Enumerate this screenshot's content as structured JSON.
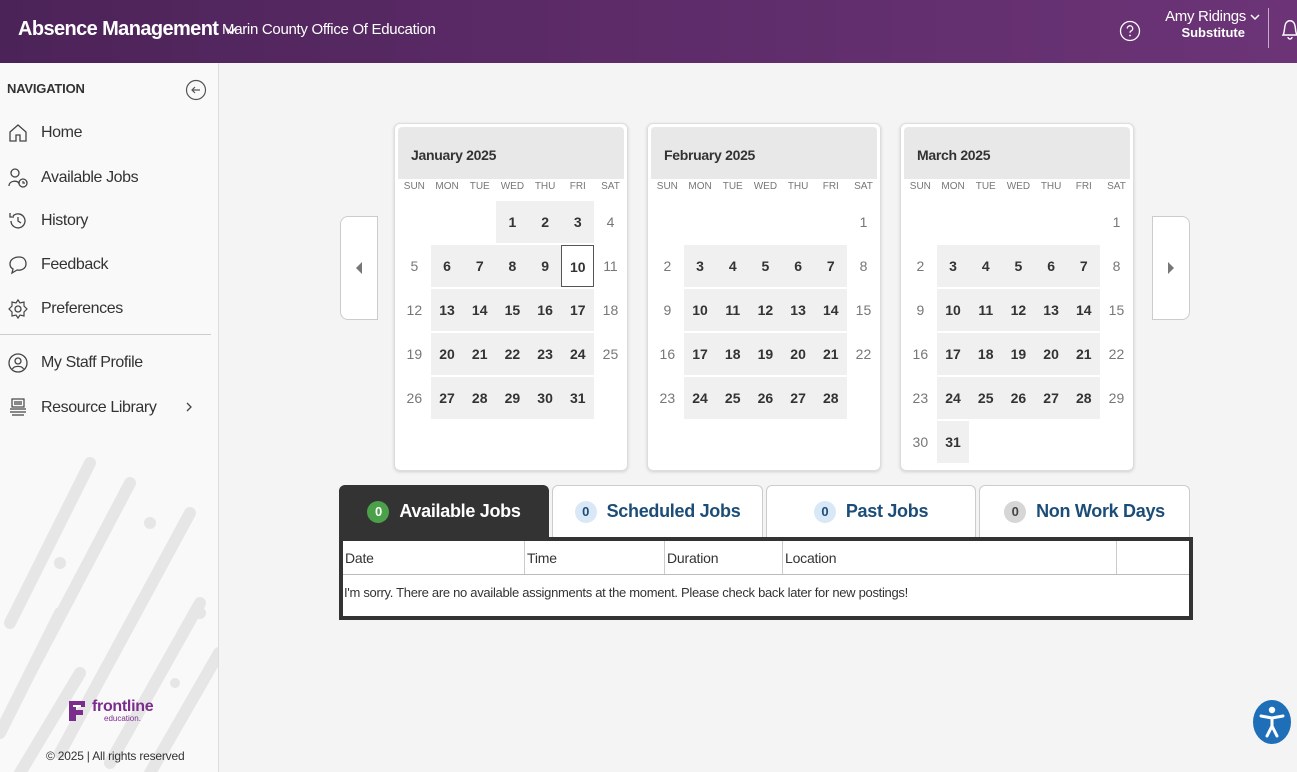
{
  "topbar": {
    "app_title": "Absence Management",
    "org_name": "Marin County Office Of Education",
    "user_name": "Amy Ridings",
    "user_role": "Substitute"
  },
  "sidebar": {
    "header": "NAVIGATION",
    "items": [
      {
        "label": "Home",
        "icon": "home-icon"
      },
      {
        "label": "Available Jobs",
        "icon": "available-jobs-icon"
      },
      {
        "label": "History",
        "icon": "history-icon"
      },
      {
        "label": "Feedback",
        "icon": "feedback-icon"
      },
      {
        "label": "Preferences",
        "icon": "gear-icon"
      },
      {
        "label": "My Staff Profile",
        "icon": "profile-icon"
      },
      {
        "label": "Resource Library",
        "icon": "library-icon"
      }
    ],
    "brand": "frontline",
    "brand_sub": "education.",
    "copyright": "© 2025 | All rights reserved"
  },
  "calendar": {
    "weekdays": [
      "SUN",
      "MON",
      "TUE",
      "WED",
      "THU",
      "FRI",
      "SAT"
    ],
    "months": [
      {
        "title": "January 2025",
        "offset": 3,
        "days": 31,
        "today": 10,
        "first_bold": 1
      },
      {
        "title": "February 2025",
        "offset": 6,
        "days": 28,
        "today": null,
        "first_bold": 1
      },
      {
        "title": "March 2025",
        "offset": 6,
        "days": 31,
        "today": null,
        "first_bold": 1
      }
    ]
  },
  "tabs": [
    {
      "label": "Available Jobs",
      "count": "0",
      "active": true
    },
    {
      "label": "Scheduled Jobs",
      "count": "0",
      "active": false
    },
    {
      "label": "Past Jobs",
      "count": "0",
      "active": false
    },
    {
      "label": "Non Work Days",
      "count": "0",
      "active": false
    }
  ],
  "jobs": {
    "columns": [
      "Date",
      "Time",
      "Duration",
      "Location",
      ""
    ],
    "empty_message": "I'm sorry. There are no available assignments at the moment. Please check back later for new postings!"
  },
  "colors": {
    "header": "#5a2a66",
    "active_tab": "#333333",
    "badge_active": "#4aa14a",
    "brand": "#7b2d8e"
  }
}
